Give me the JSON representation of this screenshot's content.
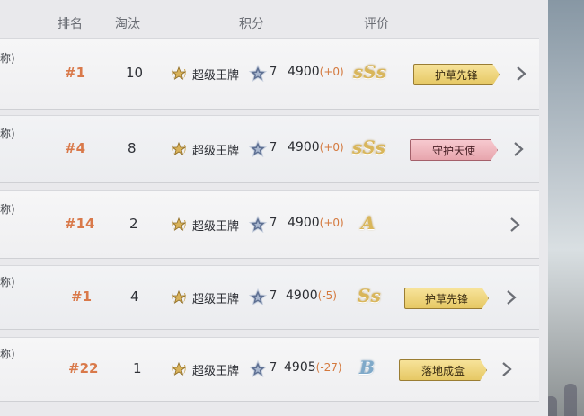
{
  "header": {
    "rank": "排名",
    "kills": "淘汰",
    "score": "积分",
    "rating": "评价"
  },
  "rows": [
    {
      "name": "称)",
      "rank": "#1",
      "kills": "10",
      "tier": "超级王牌",
      "stars": "7",
      "score": "4900",
      "delta": "(+0)",
      "grade": "sSs",
      "title": "护草先锋",
      "title_color": "gold"
    },
    {
      "name": "称)",
      "rank": "#4",
      "kills": "8",
      "tier": "超级王牌",
      "stars": "7",
      "score": "4900",
      "delta": "(+0)",
      "grade": "sSs",
      "title": "守护天使",
      "title_color": "pink"
    },
    {
      "name": "称)",
      "rank": "#14",
      "kills": "2",
      "tier": "超级王牌",
      "stars": "7",
      "score": "4900",
      "delta": "(+0)",
      "grade": "A",
      "title": "",
      "title_color": ""
    },
    {
      "name": "称)",
      "rank": "#1",
      "kills": "4",
      "tier": "超级王牌",
      "stars": "7",
      "score": "4900",
      "delta": "(-5)",
      "grade": "Ss",
      "title": "护草先锋",
      "title_color": "gold"
    },
    {
      "name": "称)",
      "rank": "#22",
      "kills": "1",
      "tier": "超级王牌",
      "stars": "7",
      "score": "4905",
      "delta": "(-27)",
      "grade": "B",
      "title": "落地成盒",
      "title_color": "gold"
    }
  ],
  "icons": {
    "tier": "gold-laurel-emblem-icon",
    "star": "silver-star-icon",
    "more": "chevron-right-icon"
  },
  "colors": {
    "rank": "#d9794a",
    "delta": "#d4793e",
    "grade_gold": "#d9b65a",
    "grade_b": "#7fa9c9"
  }
}
